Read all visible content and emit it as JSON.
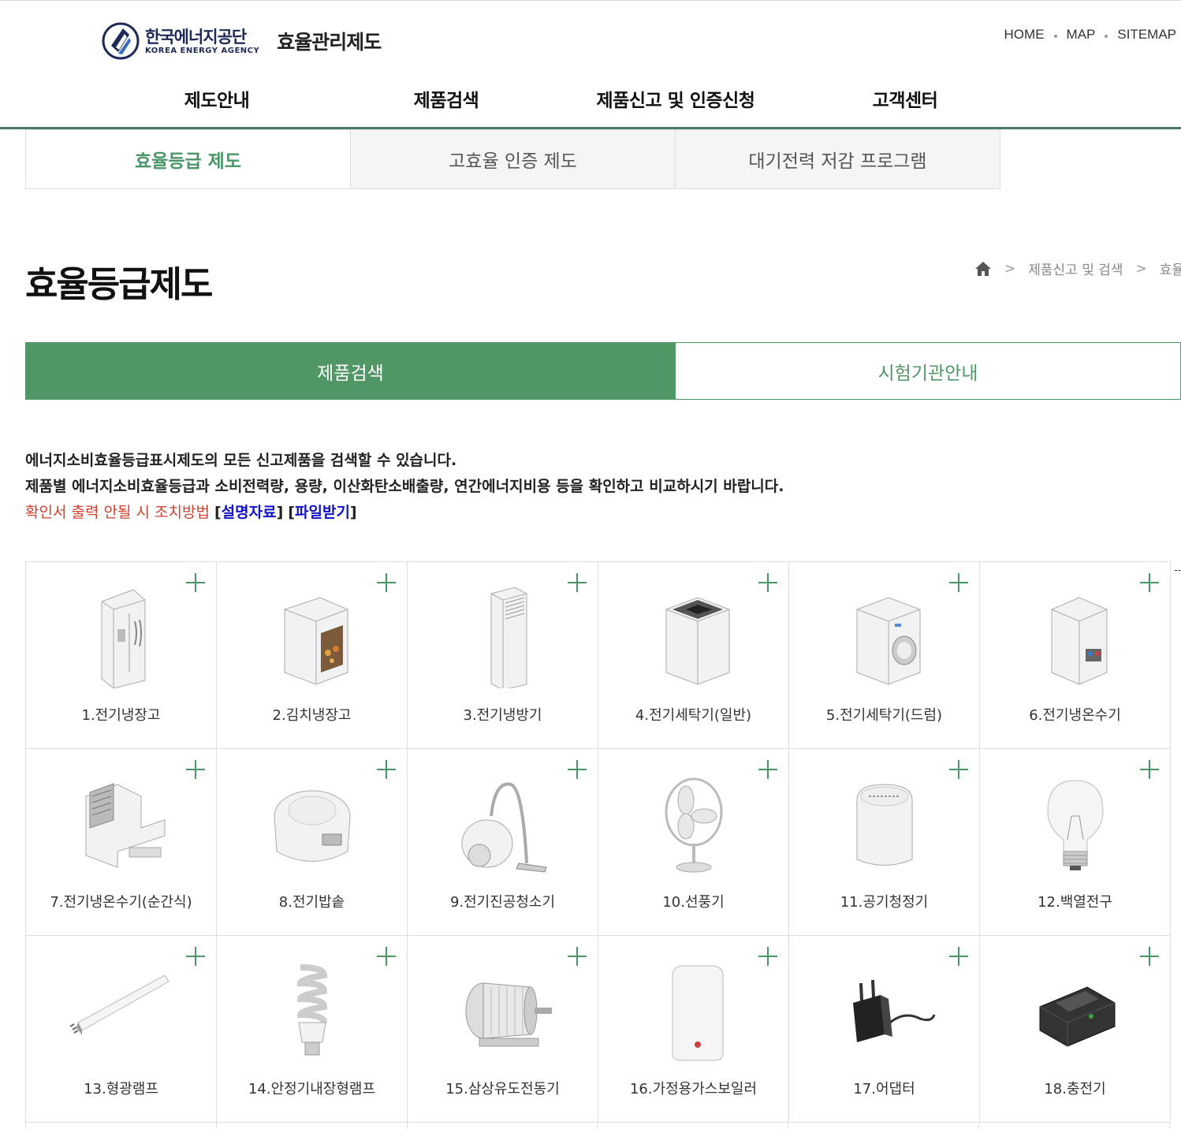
{
  "header": {
    "org_ko": "한국에너지공단",
    "org_en": "KOREA ENERGY AGENCY",
    "site_title": "효율관리제도",
    "util": [
      "HOME",
      "MAP",
      "SITEMAP"
    ]
  },
  "gnb": [
    "제도안내",
    "제품검색",
    "제품신고 및 인증신청",
    "고객센터"
  ],
  "sub_tabs": [
    "효율등급 제도",
    "고효율 인증 제도",
    "대기전력 저감 프로그램"
  ],
  "page_title": "효율등급제도",
  "breadcrumb": [
    "제품신고 및 검색",
    "효율"
  ],
  "segment": {
    "active": "제품검색",
    "inactive": "시험기관안내"
  },
  "description": {
    "line1": "에너지소비효율등급표시제도의 모든 신고제품을 검색할 수 있습니다.",
    "line2": "제품별 에너지소비효율등급과 소비전력량, 용량, 이산화탄소배출량, 연간에너지비용 등을 확인하고 비교하시기 바랍니다.",
    "line3_prefix": "확인서 출력 안될 시 조치방법",
    "link1": "설명자료",
    "link2": "파일받기"
  },
  "products": [
    {
      "label": "1.전기냉장고",
      "icon": "fridge-icon"
    },
    {
      "label": "2.김치냉장고",
      "icon": "kimchi-fridge-icon"
    },
    {
      "label": "3.전기냉방기",
      "icon": "air-conditioner-icon"
    },
    {
      "label": "4.전기세탁기(일반)",
      "icon": "top-load-washer-icon"
    },
    {
      "label": "5.전기세탁기(드럼)",
      "icon": "drum-washer-icon"
    },
    {
      "label": "6.전기냉온수기",
      "icon": "water-dispenser-icon"
    },
    {
      "label": "7.전기냉온수기(순간식)",
      "icon": "instant-dispenser-icon"
    },
    {
      "label": "8.전기밥솥",
      "icon": "rice-cooker-icon"
    },
    {
      "label": "9.전기진공청소기",
      "icon": "vacuum-cleaner-icon"
    },
    {
      "label": "10.선풍기",
      "icon": "fan-icon"
    },
    {
      "label": "11.공기청정기",
      "icon": "air-purifier-icon"
    },
    {
      "label": "12.백열전구",
      "icon": "incandescent-bulb-icon"
    },
    {
      "label": "13.형광램프",
      "icon": "fluorescent-lamp-icon"
    },
    {
      "label": "14.안정기내장형램프",
      "icon": "cfl-lamp-icon"
    },
    {
      "label": "15.삼상유도전동기",
      "icon": "motor-icon"
    },
    {
      "label": "16.가정용가스보일러",
      "icon": "gas-boiler-icon"
    },
    {
      "label": "17.어댑터",
      "icon": "adapter-icon"
    },
    {
      "label": "18.충전기",
      "icon": "charger-icon"
    }
  ],
  "colors": {
    "accent": "#519766",
    "nav_border": "#4a7a66",
    "logo": "#1e2a5a",
    "warn": "#d2402f",
    "link": "#1111cc"
  }
}
